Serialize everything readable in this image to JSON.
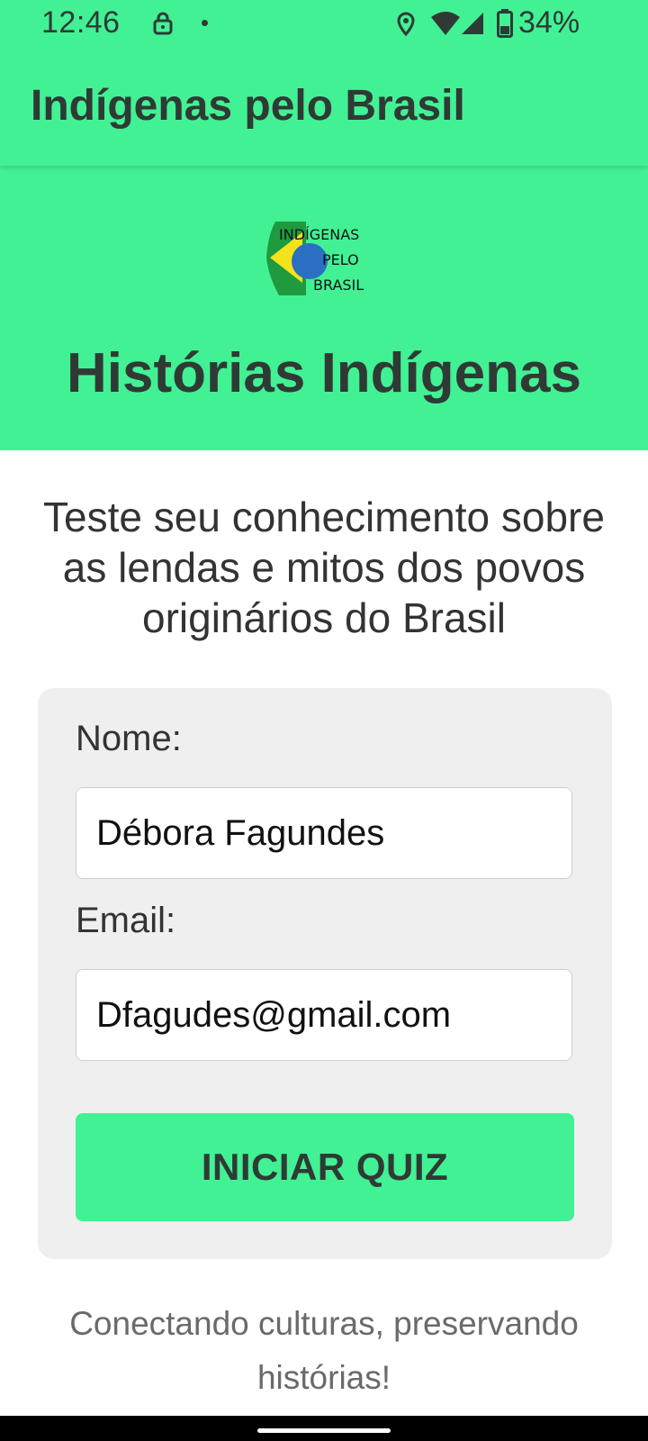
{
  "status_bar": {
    "time": "12:46",
    "battery": "34%",
    "icons": [
      "lock-icon",
      "notification-dot-icon",
      "location-icon",
      "wifi-icon",
      "cell-signal-icon",
      "battery-icon"
    ]
  },
  "app_bar": {
    "title": "Indígenas pelo Brasil"
  },
  "hero": {
    "logo_text": [
      "INDÍGENAS",
      "PELO",
      "BRASIL"
    ],
    "title": "Histórias Indígenas"
  },
  "intro": {
    "text": "Teste seu conhecimento sobre as lendas e mitos dos povos originários do Brasil"
  },
  "form": {
    "name_label": "Nome:",
    "name_value": "Débora Fagundes",
    "email_label": "Email:",
    "email_value": "Dfagudes@gmail.com",
    "start_button": "INICIAR QUIZ"
  },
  "footer": {
    "text": "Conectando culturas, preservando histórias!"
  },
  "colors": {
    "primary_green": "#42f194",
    "text_dark": "#2f3a35",
    "card_bg": "#efefef"
  }
}
